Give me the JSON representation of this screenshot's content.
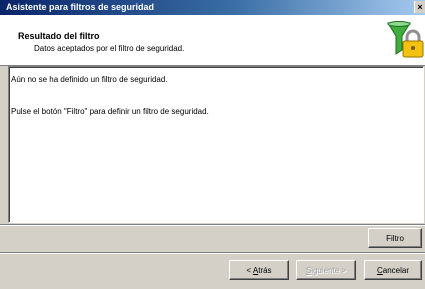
{
  "window": {
    "title": "Asistente para filtros de seguridad",
    "close_glyph": "×"
  },
  "header": {
    "title": "Resultado del filtro",
    "subtitle": "Datos aceptados por el filtro de seguridad.",
    "icon": "funnel-lock-icon"
  },
  "content": {
    "lines": [
      "Aún no se ha definido un filtro de seguridad.",
      "Pulse el botón \"Filtro\" para definir un filtro de seguridad."
    ]
  },
  "buttons": {
    "filter": "Filtro",
    "back_prefix": "< ",
    "back_mnemonic": "A",
    "back_rest": "trás",
    "next_mnemonic": "S",
    "next_rest": "iguiente >",
    "cancel_mnemonic": "C",
    "cancel_rest": "ancelar"
  },
  "colors": {
    "title_gradient_start": "#0a246a",
    "title_gradient_end": "#a6caf0",
    "face": "#d4d0c8"
  }
}
